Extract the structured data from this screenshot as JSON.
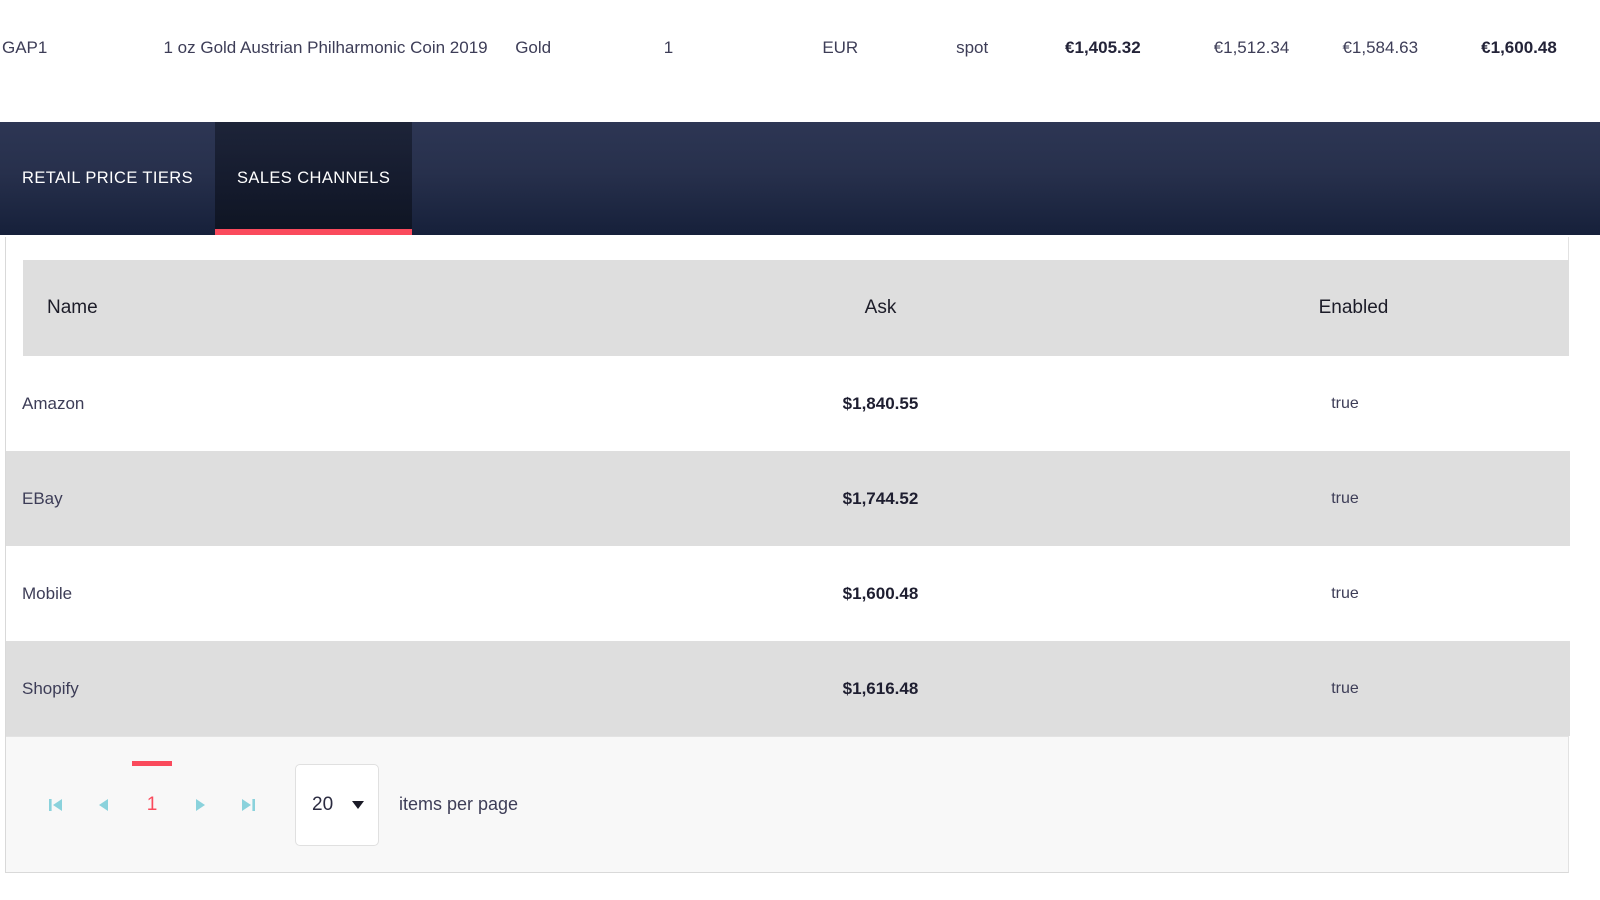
{
  "summary_row": {
    "sku": "GAP1",
    "description": "1 oz Gold Austrian Philharmonic Coin 2019",
    "metal": "Gold",
    "quantity": "1",
    "currency": "EUR",
    "price_type": "spot",
    "price_1": "€1,405.32",
    "price_2": "€1,512.34",
    "price_3": "€1,584.63",
    "price_4": "€1,600.48"
  },
  "tabs": [
    {
      "label": "RETAIL PRICE TIERS",
      "active": false
    },
    {
      "label": "SALES CHANNELS",
      "active": true
    }
  ],
  "grid": {
    "columns": {
      "name": "Name",
      "ask": "Ask",
      "enabled": "Enabled"
    },
    "rows": [
      {
        "name": "Amazon",
        "ask": "$1,840.55",
        "enabled": "true"
      },
      {
        "name": "EBay",
        "ask": "$1,744.52",
        "enabled": "true"
      },
      {
        "name": "Mobile",
        "ask": "$1,600.48",
        "enabled": "true"
      },
      {
        "name": "Shopify",
        "ask": "$1,616.48",
        "enabled": "true"
      }
    ]
  },
  "pager": {
    "first_icon": "go-to-first-page-icon",
    "prev_icon": "go-to-previous-page-icon",
    "current_page": "1",
    "next_icon": "go-to-next-page-icon",
    "last_icon": "go-to-last-page-icon",
    "page_size": "20",
    "page_size_caret_icon": "chevron-down-icon",
    "items_per_page_label": "items per page"
  },
  "colors": {
    "accent_red": "#fa4a5c",
    "tab_navy_top": "#2d3654",
    "tab_navy_bottom": "#16203a",
    "tab_active_bg": "#141a2c",
    "row_alt_bg": "#dedede",
    "header_bg": "#dedede",
    "pager_bg": "#f8f8f8",
    "pager_icon_teal": "#8ad2dc",
    "text_primary": "#2b2b40"
  }
}
